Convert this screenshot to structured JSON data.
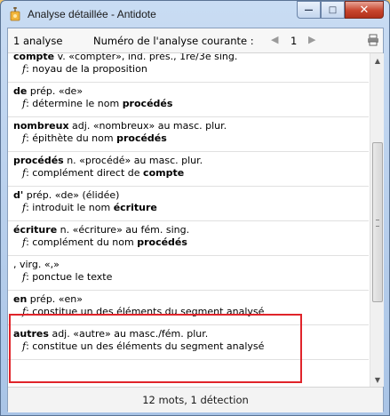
{
  "window": {
    "title": "Analyse détaillée - Antidote",
    "minimize_glyph": "—",
    "maximize_glyph": "□",
    "close_glyph": "✕",
    "accent": "#e0242a"
  },
  "toolbar": {
    "analysis_count": "1 analyse",
    "current_label": "Numéro de l'analyse courante :",
    "prev_glyph": "◀",
    "page_number": "1",
    "next_glyph": "▶",
    "print_icon": "printer-icon"
  },
  "entries": [
    {
      "word": "compte",
      "desc": " v. «compter», ind. prés., 1re/3e sing.",
      "f": "f",
      "func": ": noyau de la proposition",
      "func_bold": "",
      "cut": true
    },
    {
      "word": "de",
      "desc": " prép. «de»",
      "f": "f",
      "func": ": détermine le nom ",
      "func_bold": "procédés"
    },
    {
      "word": "nombreux",
      "desc": " adj. «nombreux» au masc. plur.",
      "f": "f",
      "func": ": épithète du nom ",
      "func_bold": "procédés"
    },
    {
      "word": "procédés",
      "desc": " n. «procédé» au masc. plur.",
      "f": "f",
      "func": ": complément direct de ",
      "func_bold": "compte"
    },
    {
      "word": "d'",
      "desc": " prép. «de» (élidée)",
      "f": "f",
      "func": ": introduit le nom ",
      "func_bold": "écriture"
    },
    {
      "word": "écriture",
      "desc": " n. «écriture» au fém. sing.",
      "f": "f",
      "func": ": complément du nom ",
      "func_bold": "procédés"
    },
    {
      "word": "",
      "desc": ", virg. «,»",
      "f": "f",
      "func": ": ponctue le texte",
      "func_bold": ""
    },
    {
      "word": "en",
      "desc": " prép. «en»",
      "f": "f",
      "func": ": constitue un des éléments du segment analysé",
      "func_bold": ""
    },
    {
      "word": "autres",
      "desc": " adj. «autre» au masc./fém. plur.",
      "f": "f",
      "func": ": constitue un des éléments du segment analysé",
      "func_bold": ""
    }
  ],
  "status": {
    "text": "12 mots, 1 détection"
  }
}
